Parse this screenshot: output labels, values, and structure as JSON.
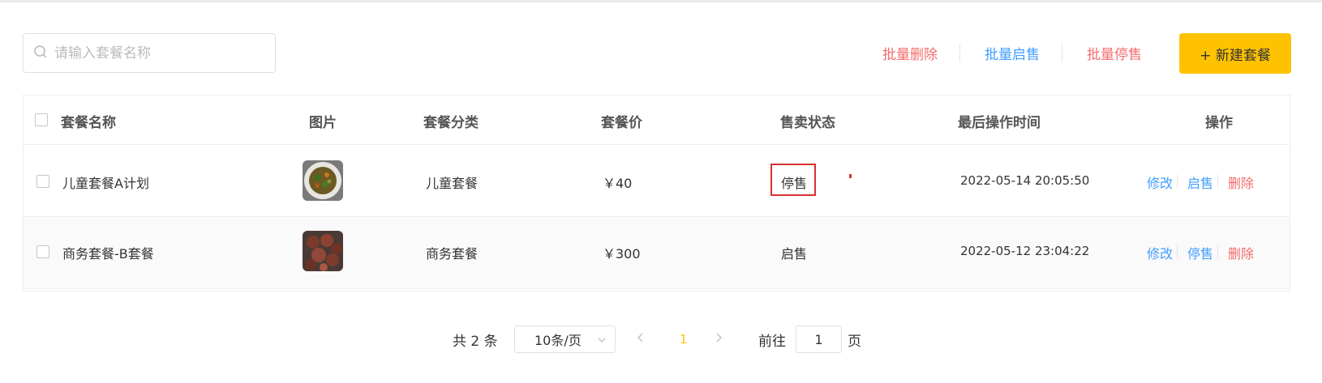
{
  "search": {
    "placeholder": "请输入套餐名称",
    "value": ""
  },
  "toolbar": {
    "batch_delete": "批量删除",
    "batch_on_sale": "批量启售",
    "batch_stop_sale": "批量停售",
    "new_button": "+ 新建套餐"
  },
  "table": {
    "headers": [
      "套餐名称",
      "图片",
      "套餐分类",
      "套餐价",
      "售卖状态",
      "最后操作时间",
      "操作"
    ],
    "rows": [
      {
        "name": "儿童套餐A计划",
        "category": "儿童套餐",
        "price": "￥40",
        "status": "停售",
        "updated": "2022-05-14 20:05:50",
        "actions": [
          "修改",
          "启售",
          "删除"
        ]
      },
      {
        "name": "商务套餐-B套餐",
        "category": "商务套餐",
        "price": "￥300",
        "status": "启售",
        "updated": "2022-05-12 23:04:22",
        "actions": [
          "修改",
          "停售",
          "删除"
        ]
      }
    ]
  },
  "pagination": {
    "total": "共 2 条",
    "page_size": "10条/页",
    "current_page": "1",
    "goto_label": "前往",
    "goto_value": "1",
    "page_unit": "页"
  },
  "colors": {
    "accent": "#ffc200",
    "danger": "#f56c6c",
    "link": "#419eff",
    "highlight_box": "#d9302f"
  },
  "icons": [
    "search-icon",
    "chevron-down-icon",
    "chevron-left-icon",
    "chevron-right-icon"
  ]
}
